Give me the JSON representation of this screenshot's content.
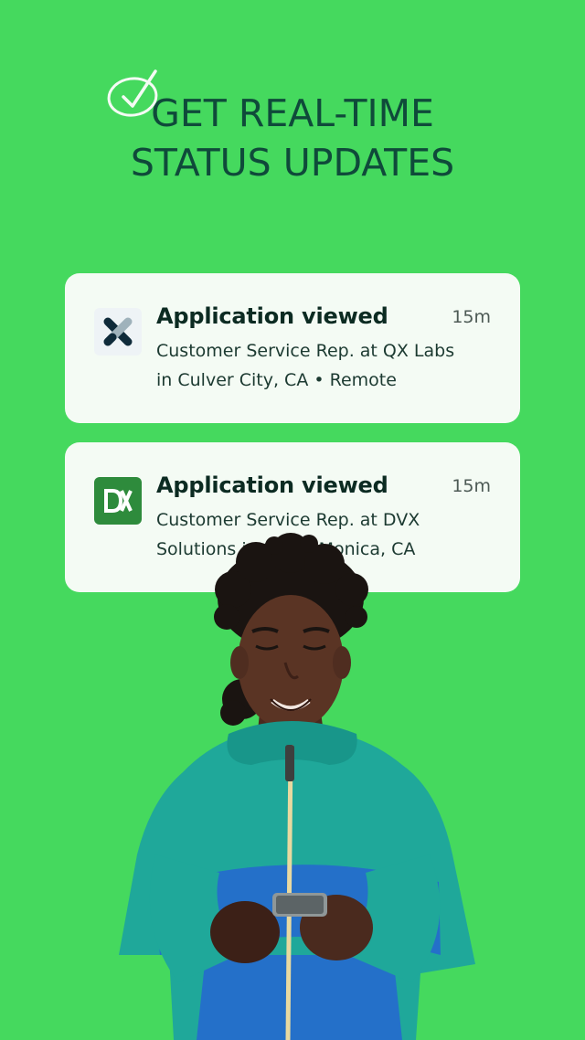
{
  "headline": {
    "line1": "GET REAL-TIME",
    "line2": "STATUS UPDATES"
  },
  "notifications": [
    {
      "title": "Application viewed",
      "time": "15m",
      "line1": "Customer Service Rep. at QX Labs",
      "line2": "in Culver City, CA • Remote",
      "logo": "qx-labs-logo"
    },
    {
      "title": "Application viewed",
      "time": "15m",
      "line1": "Customer Service Rep. at DVX",
      "line2": "Solutions in Santa Monica, CA",
      "logo": "dvx-solutions-logo"
    }
  ],
  "colors": {
    "background": "#45d95e",
    "headline": "#0f4a3a",
    "card": "#f4fbf4",
    "dvx_logo": "#2e8b3c"
  }
}
